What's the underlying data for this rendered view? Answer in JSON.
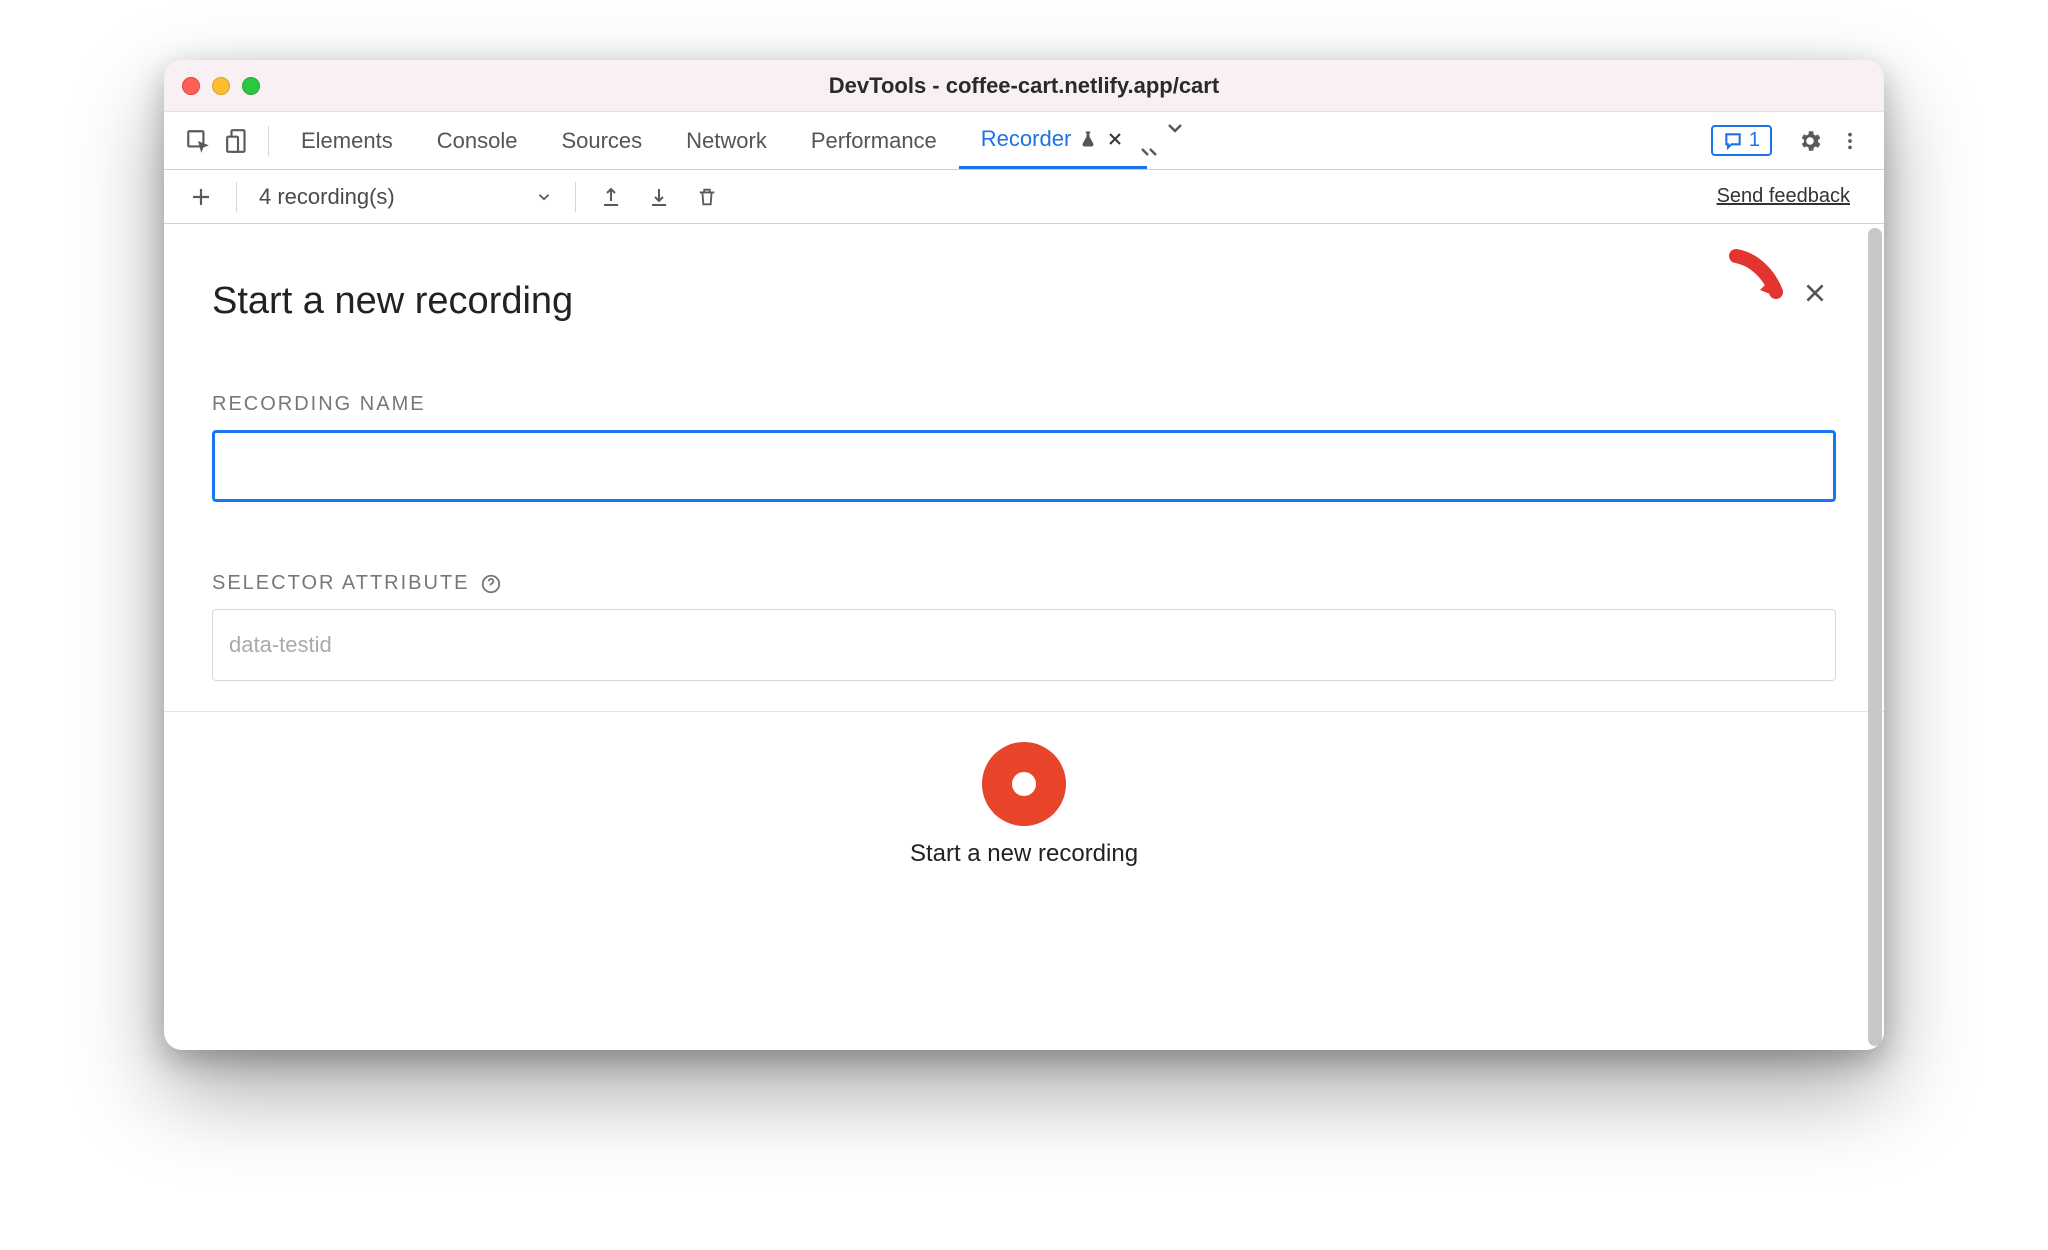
{
  "window": {
    "title": "DevTools - coffee-cart.netlify.app/cart"
  },
  "tabs": [
    {
      "label": "Elements"
    },
    {
      "label": "Console"
    },
    {
      "label": "Sources"
    },
    {
      "label": "Network"
    },
    {
      "label": "Performance"
    },
    {
      "label": "Recorder"
    }
  ],
  "issues_count": "1",
  "secondbar": {
    "dropdown_label": "4 recording(s)",
    "feedback_label": "Send feedback"
  },
  "panel": {
    "title": "Start a new recording",
    "recording_name_label": "RECORDING NAME",
    "recording_name_value": "",
    "selector_attr_label": "SELECTOR ATTRIBUTE",
    "selector_attr_placeholder": "data-testid",
    "selector_attr_value": "",
    "start_label": "Start a new recording"
  }
}
